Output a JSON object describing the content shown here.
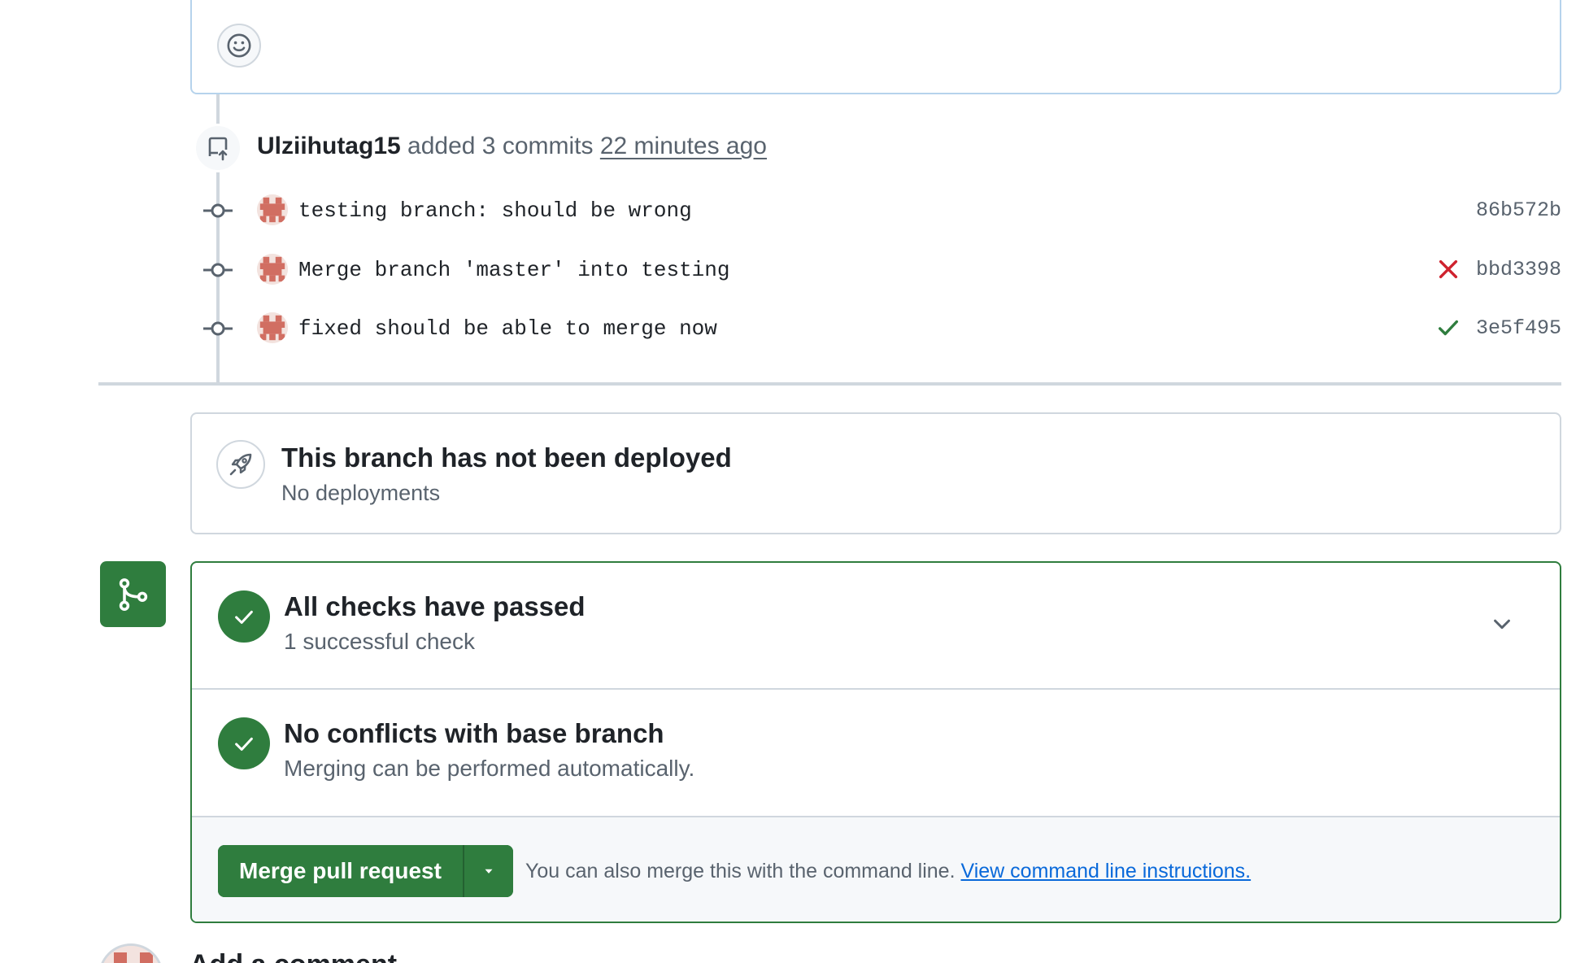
{
  "comment_box": {
    "emoji_icon": "smiley-icon"
  },
  "push_event": {
    "icon": "repo-push-icon",
    "author": "Ulziihutag15",
    "action": "added 3 commits",
    "time": "22 minutes ago"
  },
  "commits": [
    {
      "message": "testing branch: should be wrong",
      "sha": "86b572b",
      "status": "none"
    },
    {
      "message": "Merge branch 'master' into testing",
      "sha": "bbd3398",
      "status": "failure"
    },
    {
      "message": "fixed should be able to merge now",
      "sha": "3e5f495",
      "status": "success"
    }
  ],
  "deployment": {
    "icon": "rocket-icon",
    "title": "This branch has not been deployed",
    "subtitle": "No deployments"
  },
  "merge_box": {
    "side_icon": "git-merge-icon",
    "checks": {
      "title": "All checks have passed",
      "subtitle": "1 successful check"
    },
    "conflicts": {
      "title": "No conflicts with base branch",
      "subtitle": "Merging can be performed automatically."
    },
    "merge_button_label": "Merge pull request",
    "hint_text": "You can also merge this with the command line.",
    "hint_link": "View command line instructions."
  },
  "add_comment": {
    "heading": "Add a comment"
  },
  "colors": {
    "success": "#2f7d3e",
    "failure": "#cf222e",
    "link": "#0969da",
    "border": "#d0d7de"
  }
}
